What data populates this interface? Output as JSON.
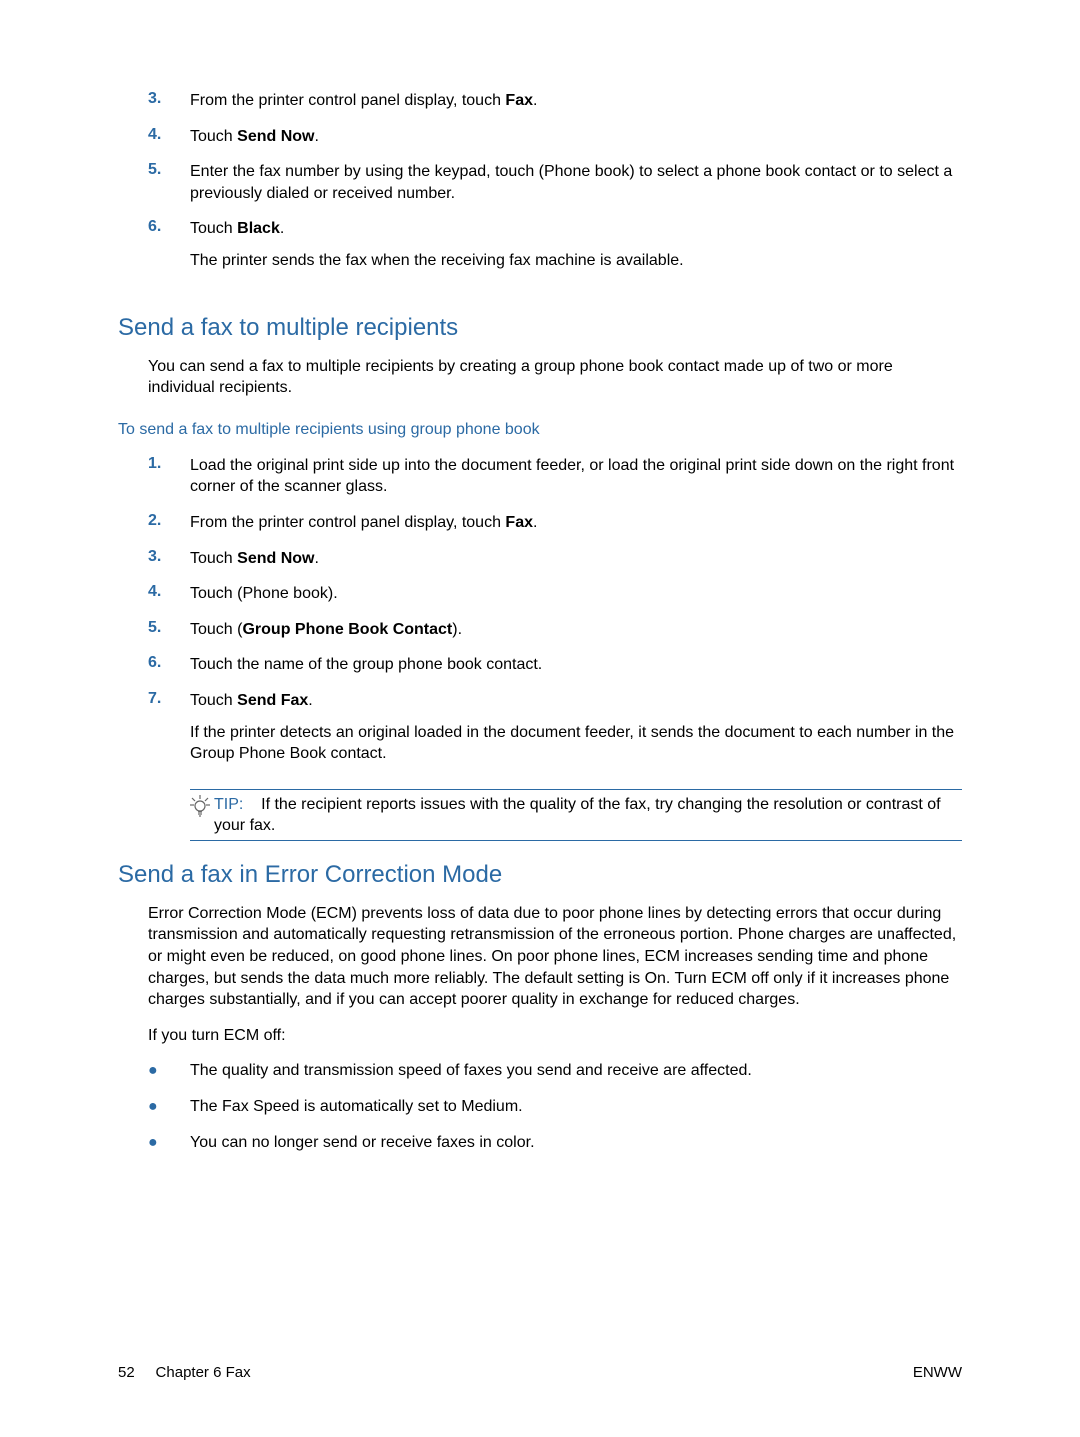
{
  "section0": {
    "steps": [
      {
        "n": "3.",
        "pre": "From the printer control panel display, touch ",
        "bold": "Fax",
        "post": "."
      },
      {
        "n": "4.",
        "pre": "Touch ",
        "bold": "Send Now",
        "post": "."
      },
      {
        "n": "5.",
        "pre": "Enter the fax number by using the keypad, touch ",
        "bold": "",
        "post": " (Phone book) to select a phone book contact or to select a previously dialed or received number."
      },
      {
        "n": "6.",
        "pre": "Touch ",
        "bold": "Black",
        "post": "."
      }
    ],
    "after6": "The printer sends the fax when the receiving fax machine is available."
  },
  "section1": {
    "heading": "Send a fax to multiple recipients",
    "intro": "You can send a fax to multiple recipients by creating a group phone book contact made up of two or more individual recipients.",
    "subheading": "To send a fax to multiple recipients using group phone book",
    "steps": [
      {
        "n": "1.",
        "text": "Load the original print side up into the document feeder, or load the original print side down on the right front corner of the scanner glass."
      },
      {
        "n": "2.",
        "pre": "From the printer control panel display, touch ",
        "bold": "Fax",
        "post": "."
      },
      {
        "n": "3.",
        "pre": "Touch ",
        "bold": "Send Now",
        "post": "."
      },
      {
        "n": "4.",
        "pre": "Touch ",
        "bold": "",
        "post": " (Phone book)."
      },
      {
        "n": "5.",
        "pre": "Touch ",
        "bold_paren_pre": " (",
        "bold": "Group Phone Book Contact",
        "bold_paren_post": ")."
      },
      {
        "n": "6.",
        "text": "Touch the name of the group phone book contact."
      },
      {
        "n": "7.",
        "pre": "Touch ",
        "bold": "Send Fax",
        "post": "."
      }
    ],
    "after7": "If the printer detects an original loaded in the document feeder, it sends the document to each number in the Group Phone Book contact.",
    "tip_label": "TIP:",
    "tip_text": "If the recipient reports issues with the quality of the fax, try changing the resolution or contrast of your fax."
  },
  "section2": {
    "heading": "Send a fax in Error Correction Mode",
    "p1_bold": "Error Correction Mode",
    "p1_a": " (ECM) prevents loss of data due to poor phone lines by detecting errors that occur during transmission and automatically requesting retransmission of the erroneous portion. Phone charges are unaffected, or might even be reduced, on good phone lines. On poor phone lines, ECM increases sending time and phone charges, but sends the data much more reliably. The default setting is ",
    "p1_on": "On",
    "p1_b": ". Turn ECM off only if it increases phone charges substantially, and if you can accept poorer quality in exchange for reduced charges.",
    "p2": "If you turn ECM off:",
    "bullets": [
      {
        "text": "The quality and transmission speed of faxes you send and receive are affected."
      },
      {
        "pre": "The ",
        "b1": "Fax Speed",
        "mid": " is automatically set to ",
        "b2": "Medium",
        "post": "."
      },
      {
        "text": "You can no longer send or receive faxes in color."
      }
    ]
  },
  "footer": {
    "page": "52",
    "chapter": "Chapter 6   Fax",
    "right": "ENWW"
  }
}
